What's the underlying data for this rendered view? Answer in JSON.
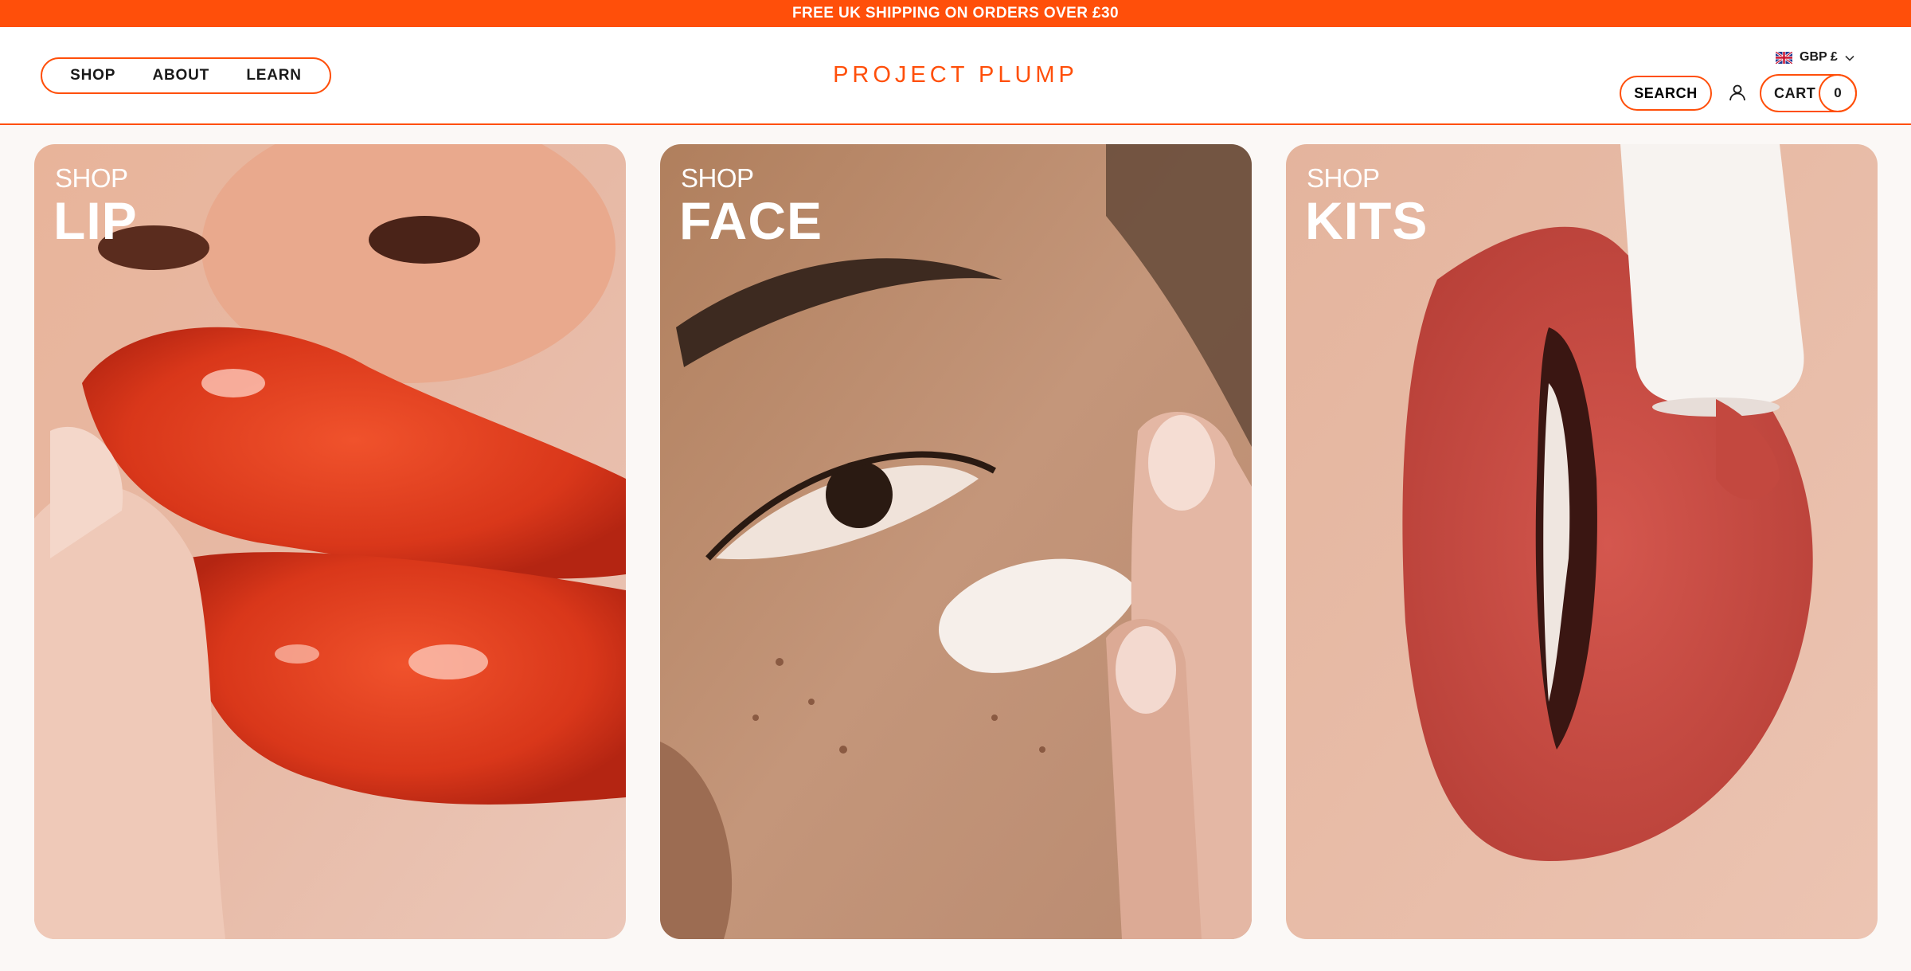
{
  "announcement": {
    "text": "FREE UK SHIPPING ON ORDERS OVER £30"
  },
  "header": {
    "nav": [
      {
        "label": "SHOP"
      },
      {
        "label": "ABOUT"
      },
      {
        "label": "LEARN"
      }
    ],
    "logo": "PROJECT PLUMP",
    "currency": {
      "label": "GBP £",
      "flag_icon": "uk-flag-icon",
      "chevron_icon": "chevron-down-icon"
    },
    "search_label": "SEARCH",
    "account_icon": "user-icon",
    "cart": {
      "label": "CART",
      "count": "0"
    }
  },
  "cards": [
    {
      "prefix": "SHOP",
      "title": "LIP"
    },
    {
      "prefix": "SHOP",
      "title": "FACE"
    },
    {
      "prefix": "SHOP",
      "title": "KITS"
    }
  ],
  "colors": {
    "accent": "#ff4f0a",
    "background": "#fbf8f6",
    "header_bg": "#ffffff"
  }
}
